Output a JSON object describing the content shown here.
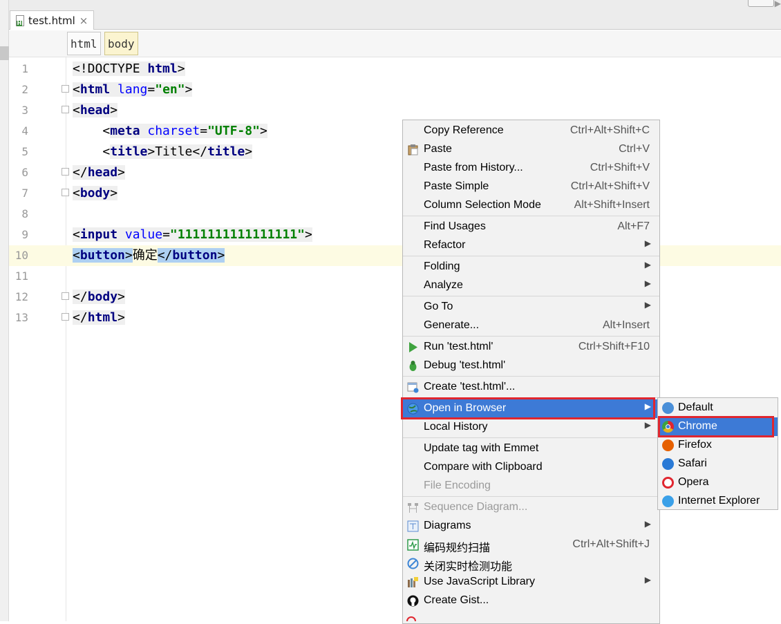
{
  "tab": {
    "label": "test.html",
    "close": "×"
  },
  "breadcrumbs": [
    "html",
    "body"
  ],
  "code_lines": [
    {
      "num": "1",
      "segments": [
        [
          "t",
          "<!DOCTYPE "
        ],
        [
          "tag",
          "html"
        ],
        [
          "t",
          ">"
        ]
      ]
    },
    {
      "num": "2",
      "segments": [
        [
          "t",
          "<"
        ],
        [
          "tag",
          "html "
        ],
        [
          "attr",
          "lang"
        ],
        [
          "t",
          "="
        ],
        [
          "str",
          "\"en\""
        ],
        [
          "t",
          ">"
        ]
      ]
    },
    {
      "num": "3",
      "segments": [
        [
          "t",
          "<"
        ],
        [
          "tag",
          "head"
        ],
        [
          "t",
          ">"
        ]
      ]
    },
    {
      "num": "4",
      "segments": [
        [
          "t",
          "    <"
        ],
        [
          "tag",
          "meta "
        ],
        [
          "attr",
          "charset"
        ],
        [
          "t",
          "="
        ],
        [
          "str",
          "\"UTF-8\""
        ],
        [
          "t",
          ">"
        ]
      ]
    },
    {
      "num": "5",
      "segments": [
        [
          "t",
          "    <"
        ],
        [
          "tag",
          "title"
        ],
        [
          "t",
          ">Title</"
        ],
        [
          "tag",
          "title"
        ],
        [
          "t",
          ">"
        ]
      ]
    },
    {
      "num": "6",
      "segments": [
        [
          "t",
          "</"
        ],
        [
          "tag",
          "head"
        ],
        [
          "t",
          ">"
        ]
      ]
    },
    {
      "num": "7",
      "segments": [
        [
          "t",
          "<"
        ],
        [
          "tag",
          "body"
        ],
        [
          "t",
          ">"
        ]
      ]
    },
    {
      "num": "8",
      "segments": []
    },
    {
      "num": "9",
      "segments": [
        [
          "t",
          "<"
        ],
        [
          "tag",
          "input "
        ],
        [
          "attr",
          "value"
        ],
        [
          "t",
          "="
        ],
        [
          "str",
          "\"1111111111111111\""
        ],
        [
          "t",
          ">"
        ]
      ]
    },
    {
      "num": "10",
      "segments": [
        [
          "hl",
          "<"
        ],
        [
          "hltag",
          "button"
        ],
        [
          "hl",
          ">"
        ],
        [
          "t",
          "确定"
        ],
        [
          "hl",
          "</"
        ],
        [
          "hltag",
          "button"
        ],
        [
          "hl",
          ">"
        ]
      ]
    },
    {
      "num": "11",
      "segments": []
    },
    {
      "num": "12",
      "segments": [
        [
          "t",
          "</"
        ],
        [
          "tag",
          "body"
        ],
        [
          "t",
          ">"
        ]
      ]
    },
    {
      "num": "13",
      "segments": [
        [
          "t",
          "</"
        ],
        [
          "tag",
          "html"
        ],
        [
          "t",
          ">"
        ]
      ]
    }
  ],
  "context_menu": {
    "items": [
      {
        "label": "Copy Reference",
        "shortcut": "Ctrl+Alt+Shift+C"
      },
      {
        "label": "Paste",
        "shortcut": "Ctrl+V",
        "icon": "clipboard-icon"
      },
      {
        "label": "Paste from History...",
        "shortcut": "Ctrl+Shift+V"
      },
      {
        "label": "Paste Simple",
        "shortcut": "Ctrl+Alt+Shift+V"
      },
      {
        "label": "Column Selection Mode",
        "shortcut": "Alt+Shift+Insert"
      },
      {
        "label": "Find Usages",
        "shortcut": "Alt+F7"
      },
      {
        "label": "Refactor",
        "submenu": true
      },
      {
        "label": "Folding",
        "submenu": true
      },
      {
        "label": "Analyze",
        "submenu": true
      },
      {
        "label": "Go To",
        "submenu": true
      },
      {
        "label": "Generate...",
        "shortcut": "Alt+Insert"
      },
      {
        "label": "Run 'test.html'",
        "shortcut": "Ctrl+Shift+F10",
        "icon": "run-icon"
      },
      {
        "label": "Debug 'test.html'",
        "icon": "debug-icon"
      },
      {
        "label": "Create 'test.html'...",
        "icon": "create-config-icon"
      },
      {
        "label": "Open in Browser",
        "submenu": true,
        "selected": true,
        "icon": "globe-icon"
      },
      {
        "label": "Local History",
        "submenu": true
      },
      {
        "label": "Update tag with Emmet"
      },
      {
        "label": "Compare with Clipboard"
      },
      {
        "label": "File Encoding",
        "disabled": true
      },
      {
        "label": "Sequence Diagram...",
        "disabled": true,
        "icon": "sequence-diagram-icon"
      },
      {
        "label": "Diagrams",
        "submenu": true,
        "icon": "diagrams-icon"
      },
      {
        "label": "编码规约扫描",
        "shortcut": "Ctrl+Alt+Shift+J",
        "icon": "code-scan-icon"
      },
      {
        "label": "关闭实时检测功能",
        "icon": "disable-icon"
      },
      {
        "label": "Use JavaScript Library",
        "submenu": true,
        "icon": "js-library-icon"
      },
      {
        "label": "Create Gist...",
        "icon": "github-icon"
      }
    ]
  },
  "browser_submenu": {
    "items": [
      {
        "label": "Default",
        "icon": "default-browser-icon",
        "color": "#4a8fd8"
      },
      {
        "label": "Chrome",
        "icon": "chrome-icon",
        "color": "#e4a11b",
        "selected": true
      },
      {
        "label": "Firefox",
        "icon": "firefox-icon",
        "color": "#e66000"
      },
      {
        "label": "Safari",
        "icon": "safari-icon",
        "color": "#2a7ad6"
      },
      {
        "label": "Opera",
        "icon": "opera-icon",
        "color": "#e0262f"
      },
      {
        "label": "Internet Explorer",
        "icon": "ie-icon",
        "color": "#3aa0e8"
      }
    ]
  }
}
